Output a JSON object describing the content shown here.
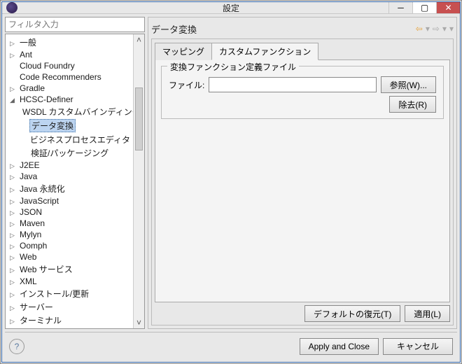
{
  "title": "設定",
  "filter_placeholder": "フィルタ入力",
  "tree": [
    {
      "label": "一般",
      "state": "collapsed",
      "indent": 0
    },
    {
      "label": "Ant",
      "state": "collapsed",
      "indent": 0
    },
    {
      "label": "Cloud Foundry",
      "state": "leaf",
      "indent": 0
    },
    {
      "label": "Code Recommenders",
      "state": "leaf",
      "indent": 0
    },
    {
      "label": "Gradle",
      "state": "collapsed",
      "indent": 0
    },
    {
      "label": "HCSC-Definer",
      "state": "expanded",
      "indent": 0
    },
    {
      "label": "WSDL カスタムバインディング",
      "state": "leaf",
      "indent": 1
    },
    {
      "label": "データ変換",
      "state": "leaf",
      "indent": 1,
      "selected": true
    },
    {
      "label": "ビジネスプロセスエディタ",
      "state": "leaf",
      "indent": 1
    },
    {
      "label": "検証/パッケージング",
      "state": "leaf",
      "indent": 1
    },
    {
      "label": "J2EE",
      "state": "collapsed",
      "indent": 0
    },
    {
      "label": "Java",
      "state": "collapsed",
      "indent": 0
    },
    {
      "label": "Java 永続化",
      "state": "collapsed",
      "indent": 0
    },
    {
      "label": "JavaScript",
      "state": "collapsed",
      "indent": 0
    },
    {
      "label": "JSON",
      "state": "collapsed",
      "indent": 0
    },
    {
      "label": "Maven",
      "state": "collapsed",
      "indent": 0
    },
    {
      "label": "Mylyn",
      "state": "collapsed",
      "indent": 0
    },
    {
      "label": "Oomph",
      "state": "collapsed",
      "indent": 0
    },
    {
      "label": "Web",
      "state": "collapsed",
      "indent": 0
    },
    {
      "label": "Web サービス",
      "state": "collapsed",
      "indent": 0
    },
    {
      "label": "XML",
      "state": "collapsed",
      "indent": 0
    },
    {
      "label": "インストール/更新",
      "state": "collapsed",
      "indent": 0
    },
    {
      "label": "サーバー",
      "state": "collapsed",
      "indent": 0
    },
    {
      "label": "ターミナル",
      "state": "collapsed",
      "indent": 0
    }
  ],
  "page_title": "データ変換",
  "tabs": {
    "mapping": "マッピング",
    "custom": "カスタムファンクション"
  },
  "group_title": "変換ファンクション定義ファイル",
  "file_label": "ファイル:",
  "file_value": "",
  "browse": "参照(W)...",
  "remove": "除去(R)",
  "restore_defaults": "デフォルトの復元(T)",
  "apply": "適用(L)",
  "apply_close": "Apply and Close",
  "cancel": "キャンセル"
}
